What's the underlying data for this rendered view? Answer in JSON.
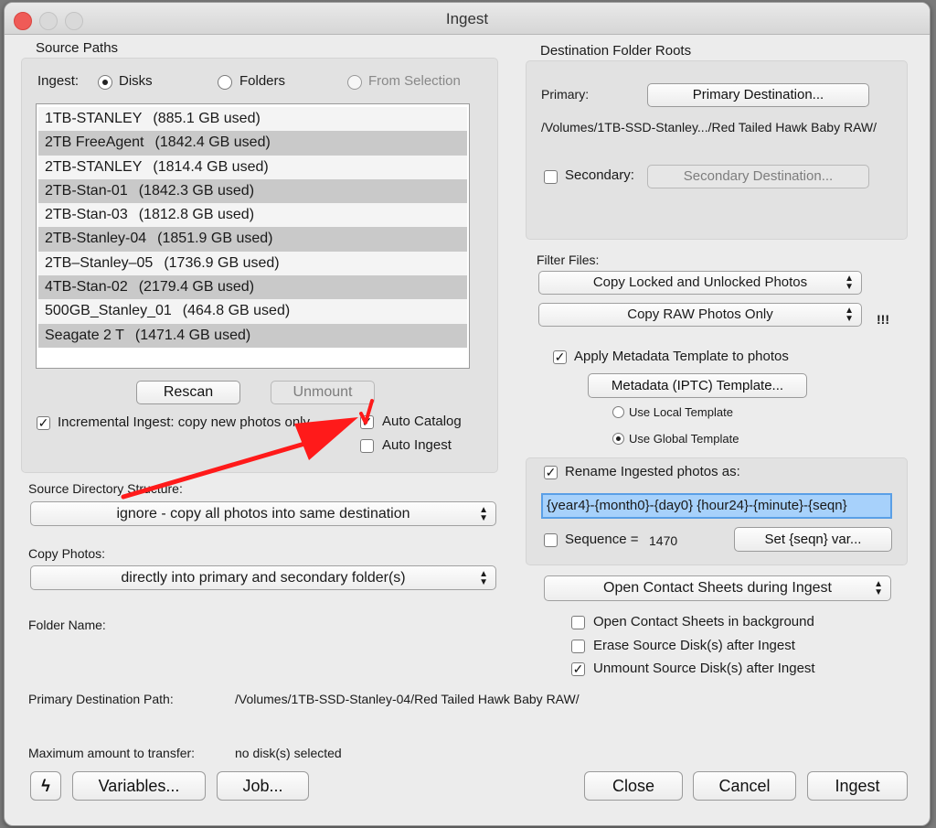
{
  "window": {
    "title": "Ingest"
  },
  "source_paths": {
    "heading": "Source Paths",
    "ingest_label": "Ingest:",
    "options": [
      {
        "label": "Disks",
        "selected": true
      },
      {
        "label": "Folders",
        "selected": false
      },
      {
        "label": "From Selection",
        "selected": false
      }
    ],
    "disks": [
      {
        "name": "1TB-STANLEY",
        "used": "(885.1 GB used)"
      },
      {
        "name": "2TB FreeAgent",
        "used": "(1842.4 GB used)"
      },
      {
        "name": "2TB-STANLEY",
        "used": "(1814.4 GB used)"
      },
      {
        "name": "2TB-Stan-01",
        "used": "(1842.3 GB used)"
      },
      {
        "name": "2TB-Stan-03",
        "used": "(1812.8 GB used)"
      },
      {
        "name": "2TB-Stanley-04",
        "used": "(1851.9 GB used)"
      },
      {
        "name": "2TB–Stanley–05",
        "used": "(1736.9 GB used)"
      },
      {
        "name": "4TB-Stan-02",
        "used": "(2179.4 GB used)"
      },
      {
        "name": "500GB_Stanley_01",
        "used": "(464.8 GB used)"
      },
      {
        "name": "Seagate 2 T",
        "used": "(1471.4 GB used)"
      }
    ],
    "rescan_label": "Rescan",
    "unmount_label": "Unmount",
    "incremental_label": "Incremental Ingest: copy new photos only",
    "incremental_checked": true,
    "auto_catalog_label": "Auto Catalog",
    "auto_catalog_checked": true,
    "auto_ingest_label": "Auto Ingest",
    "auto_ingest_checked": false
  },
  "source_directory": {
    "label": "Source Directory Structure:",
    "value": "ignore - copy all photos into same destination"
  },
  "copy_photos": {
    "label": "Copy Photos:",
    "value": "directly into primary and secondary folder(s)"
  },
  "folder_name_label": "Folder Name:",
  "primary_path": {
    "label": "Primary Destination Path:",
    "value": "/Volumes/1TB-SSD-Stanley-04/Red Tailed Hawk Baby RAW/"
  },
  "max_transfer": {
    "label": "Maximum amount to transfer:",
    "value": "no disk(s) selected"
  },
  "destination": {
    "heading": "Destination Folder Roots",
    "primary_label": "Primary:",
    "primary_button": "Primary Destination...",
    "primary_path": "/Volumes/1TB-SSD-Stanley.../Red Tailed Hawk Baby RAW/",
    "secondary_label": "Secondary:",
    "secondary_button": "Secondary Destination..."
  },
  "filter": {
    "label": "Filter Files:",
    "locked_value": "Copy Locked and Unlocked Photos",
    "raw_value": "Copy RAW Photos Only",
    "warning": "!!!"
  },
  "metadata": {
    "apply_label": "Apply Metadata Template to photos",
    "apply_checked": true,
    "template_button": "Metadata (IPTC) Template...",
    "local_label": "Use Local Template",
    "global_label": "Use Global Template"
  },
  "rename": {
    "label": "Rename Ingested photos as:",
    "checked": true,
    "value": "{year4}-{month0}-{day0} {hour24}-{minute}-{seqn}",
    "sequence_label": "Sequence =",
    "sequence_value": "1470",
    "seqn_button": "Set {seqn} var..."
  },
  "contact_sheets": {
    "value": "Open Contact Sheets during Ingest",
    "background_label": "Open Contact Sheets in background",
    "erase_label": "Erase Source Disk(s) after Ingest",
    "unmount_label": "Unmount Source Disk(s) after Ingest"
  },
  "footer": {
    "lightning": "ϟ",
    "variables": "Variables...",
    "job": "Job...",
    "close": "Close",
    "cancel": "Cancel",
    "ingest": "Ingest"
  },
  "annotation_color": "#ff1a1a"
}
